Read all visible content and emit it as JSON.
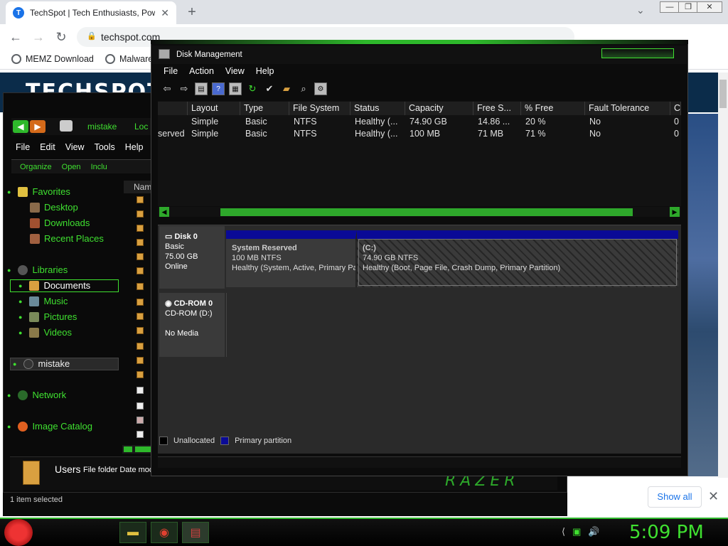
{
  "browser": {
    "tab_title": "TechSpot | Tech Enthusiasts, Pow",
    "tab_close": "✕",
    "new_tab": "+",
    "url": "techspot.com",
    "bookmarks": [
      "MEMZ Download",
      "Malware"
    ],
    "window_controls": [
      "—",
      "❐",
      "✕"
    ]
  },
  "site": {
    "logo": "TECHSPOT",
    "show_all": "Show all",
    "close": "✕"
  },
  "explorer": {
    "breadcrumb": "mistake",
    "breadcrumb_next": "Loc",
    "menu": [
      "File",
      "Edit",
      "View",
      "Tools",
      "Help"
    ],
    "commands": [
      "Organize",
      "Open",
      "Inclu"
    ],
    "column_name": "Nam",
    "nav": {
      "favorites": "Favorites",
      "desktop": "Desktop",
      "downloads": "Downloads",
      "recent": "Recent Places",
      "libraries": "Libraries",
      "documents": "Documents",
      "music": "Music",
      "pictures": "Pictures",
      "videos": "Videos",
      "mistake": "mistake",
      "network": "Network",
      "image_catalog": "Image Catalog"
    },
    "details": {
      "name": "Users",
      "meta": "File folder Date mod"
    },
    "status": "1 item selected",
    "brand": "RAZER"
  },
  "disk_management": {
    "title": "Disk Management",
    "menu": [
      "File",
      "Action",
      "View",
      "Help"
    ],
    "columns": [
      "",
      "Layout",
      "Type",
      "File System",
      "Status",
      "Capacity",
      "Free S...",
      "% Free",
      "Fault Tolerance",
      "C"
    ],
    "rows": [
      [
        "",
        "Simple",
        "Basic",
        "NTFS",
        "Healthy (...",
        "74.90 GB",
        "14.86 ...",
        "20 %",
        "No",
        "0"
      ],
      [
        "served",
        "Simple",
        "Basic",
        "NTFS",
        "Healthy (...",
        "100 MB",
        "71 MB",
        "71 %",
        "No",
        "0"
      ]
    ],
    "disk0": {
      "name": "Disk 0",
      "type": "Basic",
      "size": "75.00 GB",
      "state": "Online"
    },
    "system_reserved": {
      "name": "System Reserved",
      "fs": "100 MB NTFS",
      "status": "Healthy (System, Active, Primary Pa"
    },
    "c_drive": {
      "name": "(C:)",
      "fs": "74.90 GB NTFS",
      "status": "Healthy (Boot, Page File, Crash Dump, Primary Partition)"
    },
    "cdrom": {
      "name": "CD-ROM 0",
      "type": "CD-ROM (D:)",
      "media": "No Media"
    },
    "legend": [
      "Unallocated",
      "Primary partition"
    ],
    "colors": {
      "primary": "#0a0a96",
      "unallocated": "#000000"
    }
  },
  "taskbar": {
    "clock": "5:09 PM"
  }
}
